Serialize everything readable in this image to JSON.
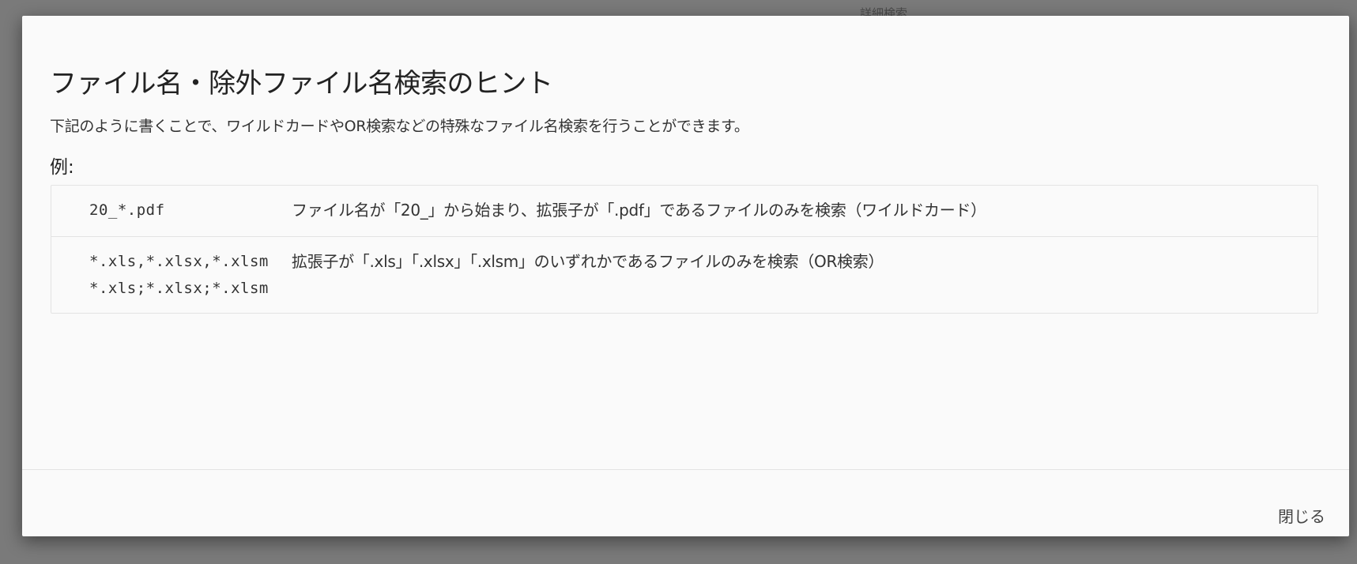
{
  "background": {
    "partial_text": "詳細検索"
  },
  "modal": {
    "title": "ファイル名・除外ファイル名検索のヒント",
    "description": "下記のように書くことで、ワイルドカードやOR検索などの特殊なファイル名検索を行うことができます。",
    "example_heading": "例:",
    "examples": [
      {
        "patterns": [
          "20_*.pdf"
        ],
        "description": "ファイル名が「20_」から始まり、拡張子が「.pdf」であるファイルのみを検索（ワイルドカード）"
      },
      {
        "patterns": [
          "*.xls,*.xlsx,*.xlsm",
          "*.xls;*.xlsx;*.xlsm"
        ],
        "description": "拡張子が「.xls」「.xlsx」「.xlsm」のいずれかであるファイルのみを検索（OR検索）"
      }
    ],
    "close_label": "閉じる"
  }
}
